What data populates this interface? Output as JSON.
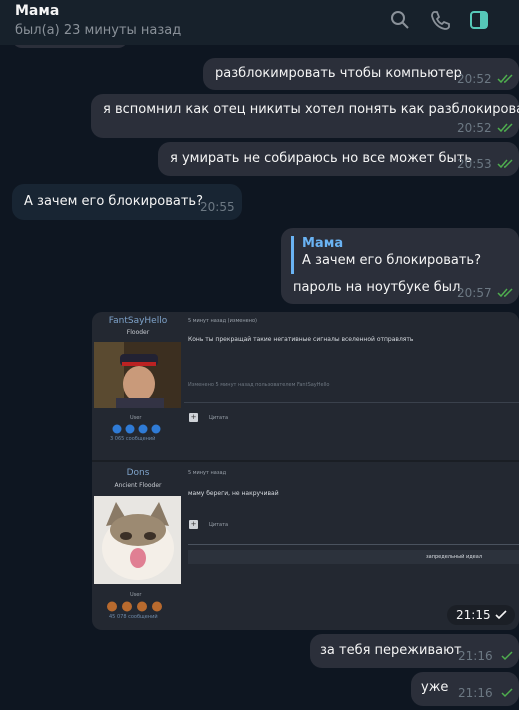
{
  "header": {
    "name": "Мама",
    "status": "был(а) 23 минуты назад",
    "icons": [
      "search-icon",
      "phone-icon",
      "sidebar-icon"
    ]
  },
  "messages": [
    {
      "text": "разблокимровать чтобы компьютер",
      "time": "20:52"
    },
    {
      "text": "я вспомнил как отец никиты хотел понять как разблокировать",
      "time": "20:52"
    },
    {
      "text": "я умирать не собираюсь но все может быть",
      "time": "20:53"
    },
    {
      "text": "А зачем его блокировать?",
      "time": "20:55"
    },
    {
      "quote_name": "Мама",
      "quote_text": "А зачем его блокировать?",
      "text": "пароль на ноутбуке был",
      "time": "20:57"
    },
    {
      "time": "21:15"
    },
    {
      "text": "за тебя переживают",
      "time": "21:16"
    },
    {
      "text": "уже",
      "time": "21:16"
    }
  ],
  "forum": {
    "post1": {
      "username": "FantSayHello",
      "role": "Flooder",
      "meta": "5 минут назад (изменено)",
      "text": "Конь ты прекращай такие негативные сигналы вселенной отправлять",
      "edited": "Изменено 5 минут назад пользователем FantSayHello",
      "quote_label": "Цитата",
      "group": "User",
      "posts": "3 065 сообщений"
    },
    "post2": {
      "username": "Dons",
      "role": "Ancient Flooder",
      "meta": "5 минут назад",
      "text": "маму береги, не накручивай",
      "quote_label": "Цитата",
      "signature": "запредельный идеал",
      "group": "User",
      "posts": "45 078 сообщений"
    }
  },
  "colors": {
    "bg": "#0e1621",
    "accent": "#6ab3f3",
    "check": "#4fae4e"
  }
}
